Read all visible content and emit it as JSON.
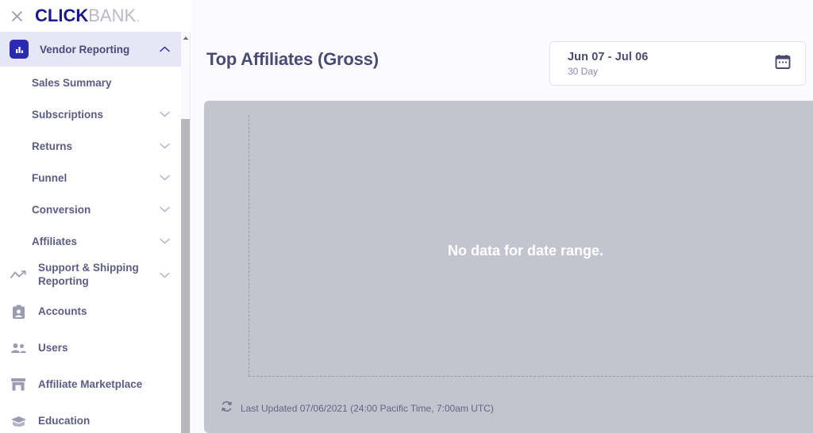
{
  "window": {
    "close_icon": "close-icon",
    "logo_primary": "CLICK",
    "logo_secondary": "BANK",
    "logo_dot": "."
  },
  "sidebar": {
    "group": {
      "label": "Vendor Reporting",
      "icon": "bar-chart-icon",
      "expanded": true,
      "chevron": "chevron-up-icon",
      "active_bg": "#e6e6f7",
      "icon_bg": "#2b2bb0"
    },
    "subitems": [
      {
        "label": "Sales Summary",
        "chevron": null
      },
      {
        "label": "Subscriptions",
        "chevron": "chevron-down-icon"
      },
      {
        "label": "Returns",
        "chevron": "chevron-down-icon"
      },
      {
        "label": "Funnel",
        "chevron": "chevron-down-icon"
      },
      {
        "label": "Conversion",
        "chevron": "chevron-down-icon"
      },
      {
        "label": "Affiliates",
        "chevron": "chevron-down-icon"
      }
    ],
    "items": [
      {
        "label": "Support & Shipping Reporting",
        "icon": "trending-line-icon",
        "chevron": "chevron-down-icon"
      },
      {
        "label": "Accounts",
        "icon": "id-badge-icon",
        "chevron": null
      },
      {
        "label": "Users",
        "icon": "people-icon",
        "chevron": null
      },
      {
        "label": "Affiliate Marketplace",
        "icon": "storefront-icon",
        "chevron": null
      },
      {
        "label": "Education",
        "icon": "graduation-cap-icon",
        "chevron": null
      }
    ],
    "scrollbar": {
      "up_arrow_icon": "caret-up-icon"
    }
  },
  "main": {
    "title": "Top Affiliates (Gross)",
    "date_range": {
      "range": "Jun 07 - Jul 06",
      "preset": "30 Day",
      "calendar_icon": "calendar-icon"
    },
    "empty_message": "No data for date range.",
    "footer": {
      "refresh_icon": "refresh-icon",
      "text": "Last Updated 07/06/2021 (24:00 Pacific Time, 7:00am UTC)"
    }
  },
  "chart_data": {
    "type": "bar",
    "title": "Top Affiliates (Gross)",
    "categories": [],
    "values": [],
    "xlabel": "",
    "ylabel": "",
    "grid": false,
    "empty": true,
    "empty_text": "No data for date range.",
    "date_range": "Jun 07 - Jul 06"
  }
}
